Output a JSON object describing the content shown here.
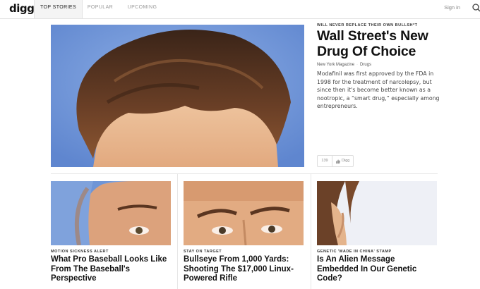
{
  "header": {
    "logo": "digg",
    "tabs": [
      {
        "label": "TOP STORIES",
        "active": true
      },
      {
        "label": "POPULAR",
        "active": false
      },
      {
        "label": "UPCOMING",
        "active": false
      }
    ],
    "signin": "Sign in",
    "search_icon": "search-icon"
  },
  "hero": {
    "kicker": "WILL NEVER REPLACE THEIR OWN BULLSH*T",
    "title": "Wall Street's New Drug Of Choice",
    "source": "New York Magazine",
    "category": "Drugs",
    "description": "Modafinil was first approved by the FDA in 1998 for the treatment of narcolepsy, but since then it's become better known as a nootropic, a “smart drug,” especially among entrepreneurs.",
    "digg_count": "139",
    "digg_label": "Digg"
  },
  "cards": [
    {
      "kicker": "MOTION SICKNESS ALERT",
      "title": "What Pro Baseball Looks Like From The Baseball's Perspective"
    },
    {
      "kicker": "STAY ON TARGET",
      "title": "Bullseye From 1,000 Yards: Shooting The $17,000 Linux-Powered Rifle"
    },
    {
      "kicker": "GENETIC 'MADE IN CHINA' STAMP",
      "title": "Is An Alien Message Embedded In Our Genetic Code?"
    }
  ],
  "colors": {
    "text": "#111111",
    "muted": "#9a9a9a",
    "divider": "#e6e6e6",
    "photo_bg": "#6f95d6"
  }
}
